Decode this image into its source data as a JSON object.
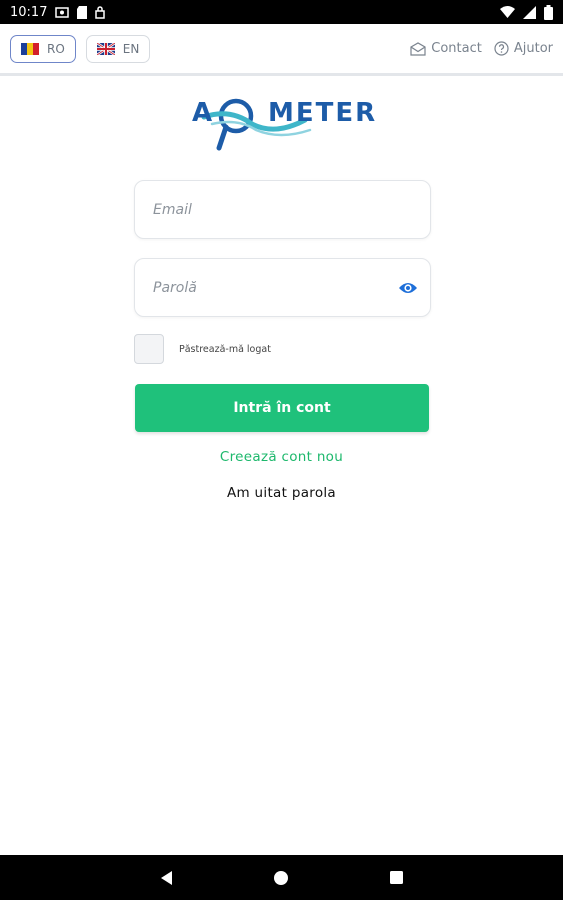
{
  "status_bar": {
    "time": "10:17",
    "left_icons": [
      "screen-record-icon",
      "sd-card-icon",
      "vpn-key-icon"
    ],
    "right_icons": [
      "wifi-icon",
      "signal-icon",
      "battery-icon"
    ]
  },
  "top_bar": {
    "languages": [
      {
        "code": "RO",
        "flag": "romania-flag-icon",
        "active": true
      },
      {
        "code": "EN",
        "flag": "uk-flag-icon",
        "active": false
      }
    ],
    "contact_label": "Contact",
    "help_label": "Ajutor"
  },
  "logo": {
    "text_a": "A",
    "text_meter": "METER"
  },
  "form": {
    "email_placeholder": "Email",
    "password_placeholder": "Parolă",
    "remember_label": "Păstrează-mă logat",
    "login_label": "Intră în cont",
    "create_account_label": "Creează cont nou",
    "forgot_password_label": "Am uitat parola"
  },
  "colors": {
    "primary_green": "#1fc17b",
    "link_green": "#1db86c",
    "brand_blue": "#1d5ca8",
    "accent_teal": "#3fb6c9"
  },
  "nav_bar": {
    "icons": [
      "back-icon",
      "home-icon",
      "recents-icon"
    ]
  }
}
